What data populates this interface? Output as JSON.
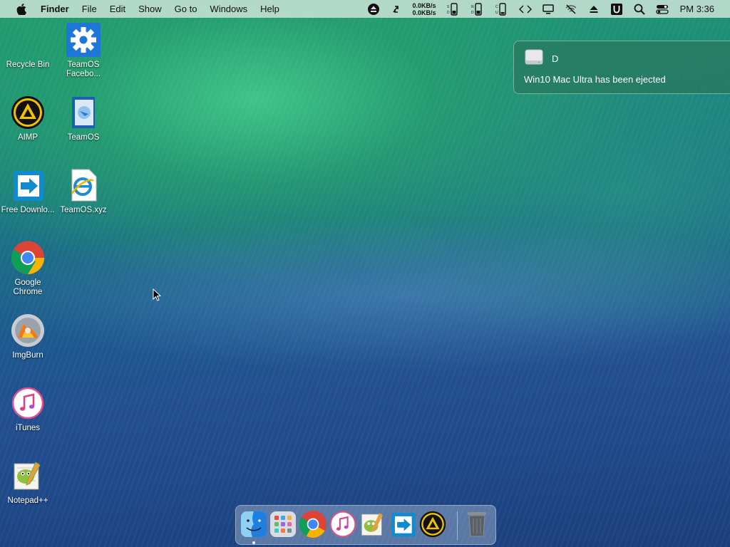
{
  "menubar": {
    "apple_icon": "apple-logo-icon",
    "app_name": "Finder",
    "menus": [
      "File",
      "Edit",
      "Show",
      "Go to",
      "Windows",
      "Help"
    ],
    "net_up": "0.0KB/s",
    "net_down": "0.0KB/s",
    "clock": "PM 3:36",
    "status_icons": [
      "eject-circle-icon",
      "sync-icon",
      "net-speed-icon",
      "battery-icon",
      "battery-icon",
      "battery-icon",
      "code-icon",
      "display-icon",
      "wifi-off-icon",
      "eject-icon",
      "u-app-icon",
      "search-icon",
      "control-center-icon"
    ]
  },
  "desktop": {
    "icons": [
      {
        "label": "Recycle Bin",
        "icon": "recycle-bin-icon"
      },
      {
        "label": "TeamOS Facebo...",
        "icon": "gear-icon"
      },
      {
        "label": "AIMP",
        "icon": "aimp-icon"
      },
      {
        "label": "TeamOS",
        "icon": "windows-file-icon"
      },
      {
        "label": "Free Downlo...",
        "icon": "download-manager-icon"
      },
      {
        "label": "TeamOS.xyz",
        "icon": "internet-explorer-icon"
      },
      {
        "label": "Google Chrome",
        "icon": "chrome-icon"
      },
      {
        "label": "ImgBurn",
        "icon": "imgburn-icon"
      },
      {
        "label": "iTunes",
        "icon": "itunes-icon"
      },
      {
        "label": "Notepad++",
        "icon": "notepadpp-icon"
      }
    ]
  },
  "notification": {
    "title": "D",
    "message": "Win10 Mac Ultra has been ejected",
    "icon": "drive-icon"
  },
  "dock": {
    "items": [
      "finder-icon",
      "launchpad-icon",
      "chrome-icon",
      "itunes-icon",
      "notepadpp-icon",
      "download-manager-icon",
      "aimp-icon",
      "trash-icon"
    ]
  },
  "colors": {
    "menubar_bg": "#d2e6dc",
    "notification_bg": "#28785f",
    "aimp_yellow": "#f2c200"
  }
}
